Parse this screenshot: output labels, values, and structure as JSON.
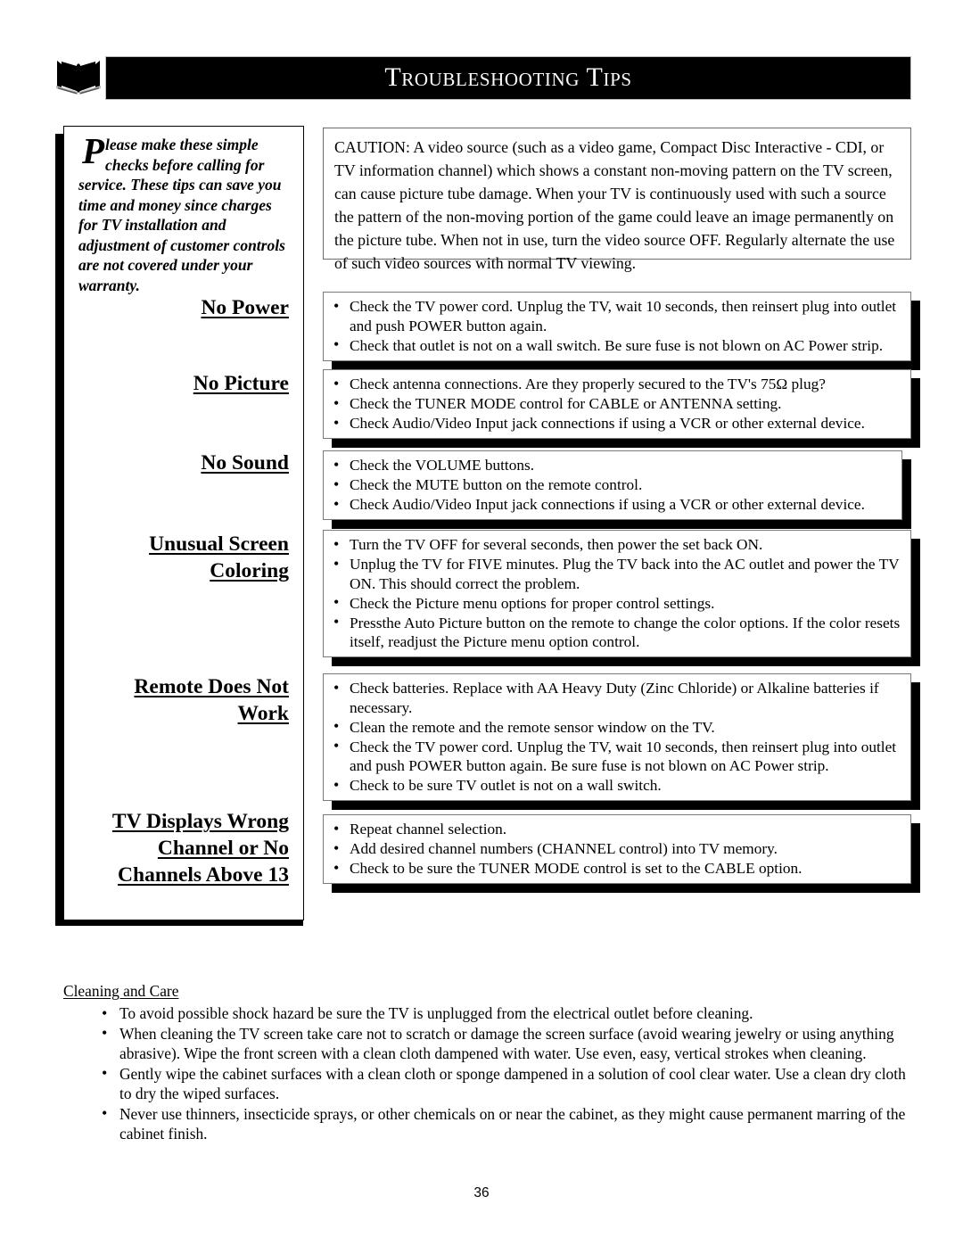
{
  "header": {
    "title": "Troubleshooting Tips",
    "icon": "open-book-icon"
  },
  "sidebar": {
    "intro": {
      "dropcap": "P",
      "text": "lease make these simple checks before calling for service. These tips can save you time and money since charges for TV installation and adjustment of customer controls are not covered under your warranty."
    },
    "headings": [
      {
        "id": "no-power",
        "label": "No Power"
      },
      {
        "id": "no-picture",
        "label": "No Picture"
      },
      {
        "id": "no-sound",
        "label": "No Sound"
      },
      {
        "id": "unusual-screen-coloring",
        "label": "Unusual Screen Coloring"
      },
      {
        "id": "remote-does-not-work",
        "label": "Remote Does Not Work"
      },
      {
        "id": "tv-displays-wrong-channel",
        "label": "TV Displays Wrong Channel or No Channels Above 13"
      }
    ]
  },
  "caution": {
    "text": "CAUTION: A video source (such as a video game, Compact Disc Interactive - CDI, or TV information channel) which shows a constant non-moving pattern on the TV screen, can cause picture tube damage.  When your TV is continuously used with such a source the pattern of the non-moving portion of the game could leave an image permanently on the picture tube.  When not in use, turn the video source OFF.  Regularly alternate the use of such video sources with normal TV viewing."
  },
  "bullet_char": "•",
  "tips": {
    "no_power": [
      "Check the TV power cord.  Unplug the TV, wait 10 seconds, then reinsert plug into outlet and push POWER button again.",
      "Check that outlet is not on a wall switch. Be sure fuse is not blown on AC Power strip."
    ],
    "no_picture": [
      "Check antenna connections.  Are they properly secured to the TV's 75Ω plug?",
      "Check the TUNER MODE control for CABLE or ANTENNA setting.",
      "Check Audio/Video Input jack connections if using a VCR or other external device."
    ],
    "no_sound": [
      "Check the VOLUME buttons.",
      "Check the MUTE button on the remote control.",
      "Check Audio/Video Input jack connections if using a VCR or other external device."
    ],
    "unusual_screen_coloring": [
      "Turn the TV OFF for several seconds, then power the set back ON.",
      "Unplug the TV for FIVE minutes. Plug the TV back into the AC outlet and power the TV ON. This should correct the problem.",
      "Check the Picture menu options for proper control settings.",
      "Pressthe Auto Picture button on the remote to change the color options. If the color resets itself, readjust the Picture menu option control."
    ],
    "remote_does_not_work": [
      "Check batteries.  Replace with AA Heavy Duty (Zinc Chloride) or Alkaline batteries if necessary.",
      "Clean the remote and the remote sensor window on the TV.",
      "Check the TV power cord.  Unplug the TV, wait 10 seconds, then reinsert plug into outlet and push POWER button again. Be sure fuse is not blown on AC Power strip.",
      "Check to be sure TV outlet is not on a wall switch."
    ],
    "tv_displays_wrong_channel": [
      "Repeat channel selection.",
      "Add desired channel numbers (CHANNEL control) into TV memory.",
      "Check to be sure the TUNER MODE control is set to the CABLE option."
    ]
  },
  "cleaning": {
    "title": "Cleaning and Care",
    "items": [
      "To avoid possible shock hazard be sure the TV is unplugged from the electrical outlet before cleaning.",
      "When cleaning the TV screen take care not to scratch or damage the screen surface (avoid wearing jewelry or using anything abrasive). Wipe the front screen with a clean cloth dampened with water. Use even, easy, vertical strokes when cleaning.",
      "Gently wipe the cabinet surfaces with a clean cloth or sponge dampened in a solution of cool clear water. Use a clean dry cloth to dry the wiped surfaces.",
      "Never use thinners, insecticide sprays, or other chemicals on or near the cabinet, as they might cause permanent marring of the cabinet finish."
    ]
  },
  "footer": {
    "page_number": "36"
  },
  "colors": {
    "page_background": "#ffffff",
    "text": "#000000",
    "title_bar_background": "#000000",
    "title_bar_text": "#ffffff",
    "box_border": "#7a7a7a",
    "shadow": "#000000"
  }
}
